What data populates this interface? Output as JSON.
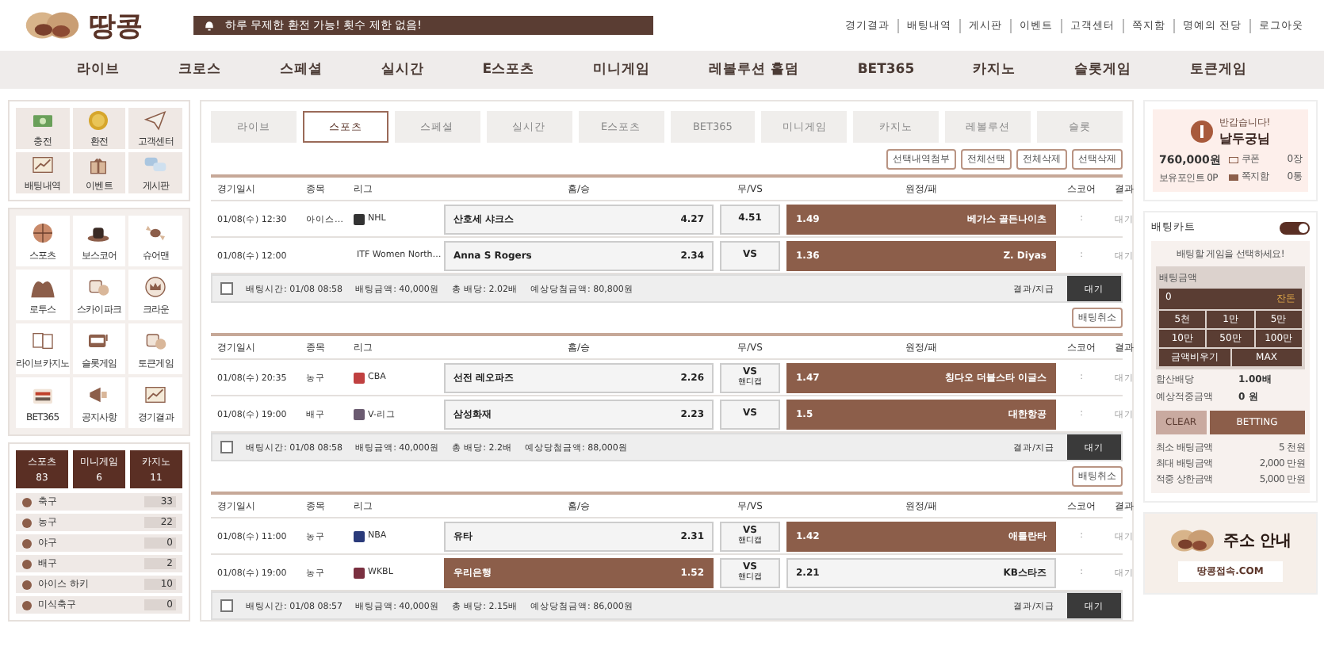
{
  "logo": {
    "text": "땅콩"
  },
  "notice": "하루 무제한 환전 가능! 횟수 제한 없음!",
  "top_links": [
    "경기결과",
    "배팅내역",
    "게시판",
    "이벤트",
    "고객센터",
    "쪽지함",
    "명예의 전당",
    "로그아웃"
  ],
  "nav": [
    "라이브",
    "크로스",
    "스페셜",
    "실시간",
    "E스포츠",
    "미니게임",
    "레볼루션 홀덤",
    "BET365",
    "카지노",
    "슬롯게임",
    "토큰게임"
  ],
  "quick_menu": [
    "충전",
    "환전",
    "고객센터",
    "배팅내역",
    "이벤트",
    "게시판"
  ],
  "game_menu": [
    "스포츠",
    "보스코어",
    "슈어맨",
    "로투스",
    "스카이파크",
    "크라운",
    "라이브카지노",
    "슬롯게임",
    "토큰게임",
    "BET365",
    "공지사항",
    "경기결과"
  ],
  "category_tabs": [
    {
      "label": "스포츠",
      "count": "83"
    },
    {
      "label": "미니게임",
      "count": "6"
    },
    {
      "label": "카지노",
      "count": "11"
    }
  ],
  "sport_list": [
    {
      "name": "축구",
      "count": "33"
    },
    {
      "name": "농구",
      "count": "22"
    },
    {
      "name": "야구",
      "count": "0"
    },
    {
      "name": "배구",
      "count": "2"
    },
    {
      "name": "아이스 하키",
      "count": "10"
    },
    {
      "name": "미식축구",
      "count": "0"
    }
  ],
  "game_tabs": [
    {
      "label": "라이브",
      "selected": false
    },
    {
      "label": "스포츠",
      "selected": true
    },
    {
      "label": "스페셜",
      "selected": false
    },
    {
      "label": "실시간",
      "selected": false
    },
    {
      "label": "E스포츠",
      "selected": false
    },
    {
      "label": "BET365",
      "selected": false
    },
    {
      "label": "미니게임",
      "selected": false
    },
    {
      "label": "카지노",
      "selected": false
    },
    {
      "label": "레볼루션",
      "selected": false
    },
    {
      "label": "슬롯",
      "selected": false
    }
  ],
  "actions": [
    "선택내역첨부",
    "전체선택",
    "전체삭제",
    "선택삭제"
  ],
  "bet_slips": [
    {
      "columns": [
        "경기일시",
        "종목",
        "리그",
        "홈/승",
        "무/VS",
        "원정/패",
        "스코어",
        "결과"
      ],
      "rows": [
        {
          "date": "01/08(수) 12:30",
          "sport": "아이스…",
          "league": "NHL",
          "home": {
            "team": "산호세 샤크스",
            "odds": "4.27",
            "selected": false
          },
          "draw": {
            "text": "4.51",
            "selected": false
          },
          "away": {
            "team": "베가스 골든나이츠",
            "odds": "1.49",
            "selected": true
          },
          "score": ":",
          "result": "대기"
        },
        {
          "date": "01/08(수) 12:00",
          "league": "ITF Women North…",
          "home": {
            "team": "Anna S Rogers",
            "odds": "2.34",
            "selected": false
          },
          "draw": {
            "text": "VS",
            "selected": false
          },
          "away": {
            "team": "Z. Diyas",
            "odds": "1.36",
            "selected": true
          },
          "score": ":",
          "result": "대기"
        }
      ],
      "summary": {
        "checked": false,
        "time": "배팅시간: 01/08 08:58",
        "amount": "배팅금액: 40,000원",
        "odds": "총 배당: 2.02배",
        "expected": "예상당첨금액: 80,800원",
        "status_label": "결과/지급",
        "status": "대기"
      },
      "cancel": "배팅취소"
    },
    {
      "columns": [
        "경기일시",
        "종목",
        "리그",
        "홈/승",
        "무/VS",
        "원정/패",
        "스코어",
        "결과"
      ],
      "rows": [
        {
          "date": "01/08(수) 20:35",
          "sport": "농구",
          "league": "CBA",
          "home": {
            "team": "선전 레오파즈",
            "odds": "2.26",
            "selected": false
          },
          "draw": {
            "text": "VS",
            "sub": "핸디캡",
            "selected": false
          },
          "away": {
            "team": "칭다오 더블스타 이글스",
            "odds": "1.47",
            "selected": true
          },
          "score": ":",
          "result": "대기"
        },
        {
          "date": "01/08(수) 19:00",
          "sport": "배구",
          "league": "V-리그",
          "home": {
            "team": "삼성화재",
            "odds": "2.23",
            "selected": false
          },
          "draw": {
            "text": "VS",
            "selected": false
          },
          "away": {
            "team": "대한항공",
            "odds": "1.5",
            "selected": true
          },
          "score": ":",
          "result": "대기"
        }
      ],
      "summary": {
        "checked": false,
        "time": "배팅시간: 01/08 08:58",
        "amount": "배팅금액: 40,000원",
        "odds": "총 배당: 2.2배",
        "expected": "예상당첨금액: 88,000원",
        "status_label": "결과/지급",
        "status": "대기"
      },
      "cancel": "배팅취소"
    },
    {
      "columns": [
        "경기일시",
        "종목",
        "리그",
        "홈/승",
        "무/VS",
        "원정/패",
        "스코어",
        "결과"
      ],
      "rows": [
        {
          "date": "01/08(수) 11:00",
          "sport": "농구",
          "league": "NBA",
          "home": {
            "team": "유타",
            "odds": "2.31",
            "selected": false
          },
          "draw": {
            "text": "VS",
            "sub": "핸디캡",
            "selected": false
          },
          "away": {
            "team": "애틀란타",
            "odds": "1.42",
            "selected": true
          },
          "score": ":",
          "result": "대기"
        },
        {
          "date": "01/08(수) 19:00",
          "sport": "농구",
          "league": "WKBL",
          "home": {
            "team": "우리은행",
            "odds": "1.52",
            "selected": true
          },
          "draw": {
            "text": "VS",
            "sub": "핸디캡",
            "selected": false
          },
          "away": {
            "team": "KB스타즈",
            "odds": "2.21",
            "selected": false
          },
          "score": ":",
          "result": "대기"
        }
      ],
      "summary": {
        "checked": false,
        "time": "배팅시간: 01/08 08:57",
        "amount": "배팅금액: 40,000원",
        "odds": "총 배당: 2.15배",
        "expected": "예상당첨금액: 86,000원",
        "status_label": "결과/지급",
        "status": "대기"
      }
    }
  ],
  "profile": {
    "greeting": "반갑습니다!",
    "name": "날두궁님",
    "balance": "760,000원",
    "points": "보유포인트 0P",
    "coupon_label": "쿠폰",
    "coupon": "0장",
    "message_label": "쪽지함",
    "messages": "0통"
  },
  "cart": {
    "title": "배팅카트",
    "on": true,
    "hint": "배팅할 게임을 선택하세요!",
    "amount_label": "배팅금액",
    "amount": "0",
    "change_label": "잔돈",
    "quick_amounts": [
      "5천",
      "1만",
      "5만",
      "10만",
      "50만",
      "100만"
    ],
    "clear_amount": "금액비우기",
    "max": "MAX",
    "stats": [
      {
        "label": "합산배당",
        "value": "1.00배"
      },
      {
        "label": "예상적중금액",
        "value": "0 원"
      }
    ],
    "clear": "CLEAR",
    "bet": "BETTING",
    "limits": [
      {
        "label": "최소 배팅금액",
        "value": "5 천원"
      },
      {
        "label": "최대 배팅금액",
        "value": "2,000 만원"
      },
      {
        "label": "적중 상한금액",
        "value": "5,000 만원"
      }
    ]
  },
  "banner": {
    "title": "주소 안내",
    "address": "땅콩접속.COM"
  }
}
